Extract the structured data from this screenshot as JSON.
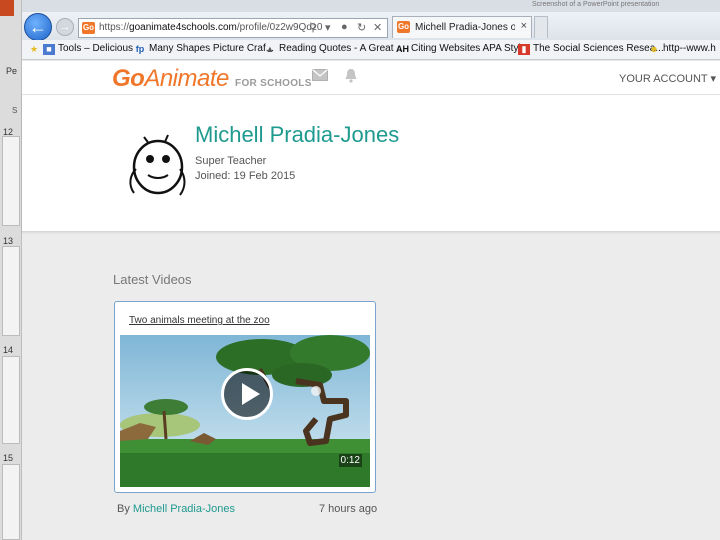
{
  "side_strip": {
    "label": "Pe",
    "small": "S",
    "slide_numbers": [
      "12",
      "13",
      "14",
      "15"
    ]
  },
  "browser": {
    "ghost_title": "Screenshot of a PowerPoint presentation",
    "address_url_prefix": "https://",
    "address_url_domain": "goanimate4schools.com",
    "address_url_path": "/profile/0z2w9Qdz0",
    "tab_title": "Michell Pradia-Jones on Go...",
    "favicon_text": "Go",
    "favorites": [
      {
        "label": "Tools – Delicious",
        "icon": "star-icon"
      },
      {
        "label": "Many Shapes Picture Craf...",
        "icon": "fp-icon"
      },
      {
        "label": "Reading Quotes - A Great ...",
        "icon": "mountain-icon"
      },
      {
        "label": "Citing Websites APA Style",
        "icon": "ah-icon"
      },
      {
        "label": "The Social Sciences Resea...",
        "icon": "book-icon"
      },
      {
        "label": "http--www.h",
        "icon": "smiley-icon"
      }
    ]
  },
  "header": {
    "logo_go": "Go",
    "logo_animate": "Animate",
    "logo_schools": "FOR SCHOOLS",
    "account": "YOUR ACCOUNT"
  },
  "profile": {
    "name": "Michell Pradia-Jones",
    "role": "Super Teacher",
    "joined": "Joined: 19 Feb 2015"
  },
  "videos": {
    "section_title": "Latest Videos",
    "items": [
      {
        "title": "Two animals meeting at the zoo",
        "duration": "0:12",
        "by_prefix": "By",
        "author": "Michell Pradia-Jones",
        "ago": "7 hours ago"
      }
    ]
  }
}
